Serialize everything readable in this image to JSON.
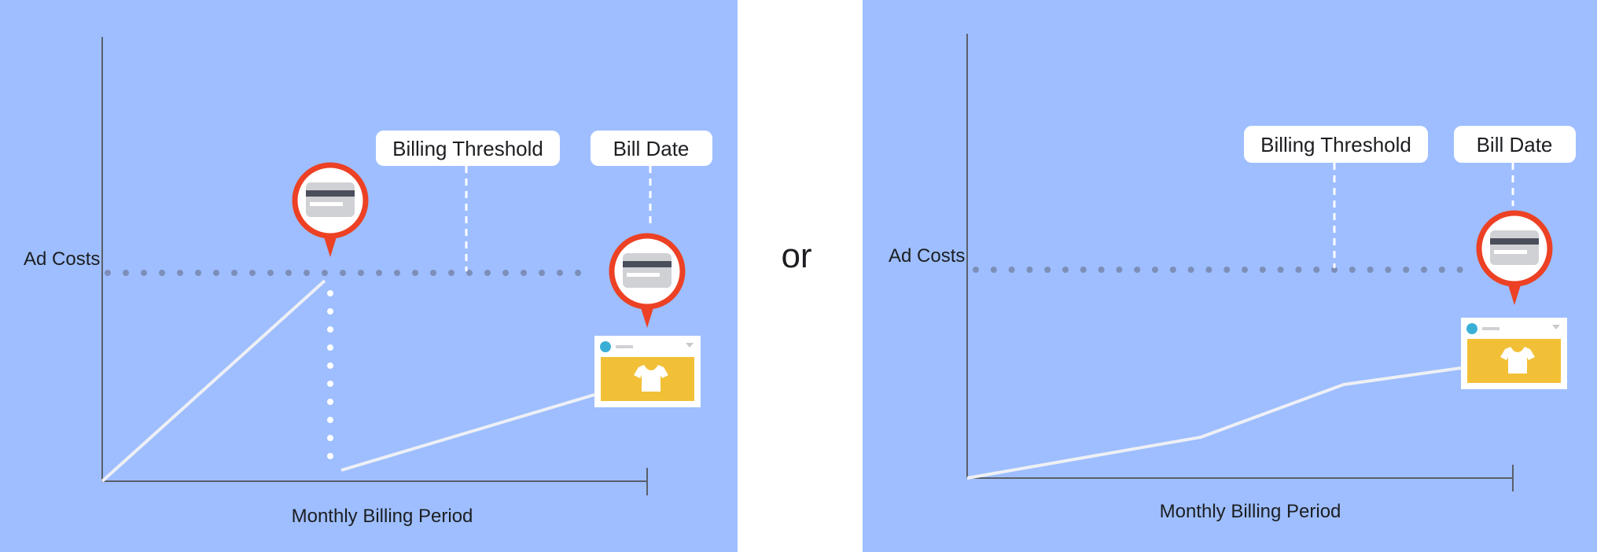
{
  "separator": "or",
  "colors": {
    "background": "#9ebeff",
    "pin_ring": "#ec4124",
    "card_stripe": "#4b4f5c",
    "card_body": "#d0d1d5",
    "ad_image": "#f2c037",
    "avatar": "#3aafd6"
  },
  "panels": [
    {
      "y_axis_label": "Ad Costs",
      "x_axis_label": "Monthly Billing Period",
      "threshold_label": "Billing Threshold",
      "bill_date_label": "Bill Date",
      "icons": [
        "credit-card-pin-icon",
        "credit-card-pin-icon",
        "ad-post-icon"
      ]
    },
    {
      "y_axis_label": "Ad Costs",
      "x_axis_label": "Monthly Billing Period",
      "threshold_label": "Billing Threshold",
      "bill_date_label": "Bill Date",
      "icons": [
        "credit-card-pin-icon",
        "ad-post-icon"
      ]
    }
  ]
}
